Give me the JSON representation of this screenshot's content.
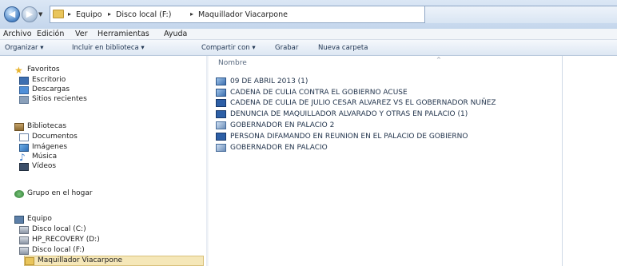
{
  "address_bar": {
    "back_icon": "back-arrow-icon",
    "forward_icon": "forward-arrow-icon",
    "recent_icon": "chevron-down-icon",
    "folder_icon": "folder-icon",
    "breadcrumbs": [
      "Equipo",
      "Disco local (F:)",
      "Maquillador Viacarpone"
    ]
  },
  "menu": {
    "items": [
      "Archivo",
      "Edición",
      "Ver",
      "Herramientas",
      "Ayuda"
    ]
  },
  "command_bar": {
    "items": [
      "Organizar ▾",
      "Incluir en biblioteca ▾",
      "Compartir con ▾",
      "Grabar",
      "Nueva carpeta"
    ]
  },
  "nav": {
    "favorites": {
      "label": "Favoritos",
      "icon": "star-icon",
      "items": [
        {
          "label": "Escritorio",
          "icon": "desktop-icon"
        },
        {
          "label": "Descargas",
          "icon": "downloads-icon"
        },
        {
          "label": "Sitios recientes",
          "icon": "recent-places-icon"
        }
      ]
    },
    "libraries": {
      "label": "Bibliotecas",
      "icon": "libraries-icon",
      "items": [
        {
          "label": "Documentos",
          "icon": "documents-icon"
        },
        {
          "label": "Imágenes",
          "icon": "pictures-icon"
        },
        {
          "label": "Música",
          "icon": "music-icon"
        },
        {
          "label": "Vídeos",
          "icon": "videos-icon"
        }
      ]
    },
    "homegroup": {
      "label": "Grupo en el hogar",
      "icon": "homegroup-icon"
    },
    "computer": {
      "label": "Equipo",
      "icon": "computer-icon",
      "items": [
        {
          "label": "Disco local (C:)",
          "icon": "drive-icon"
        },
        {
          "label": "HP_RECOVERY (D:)",
          "icon": "drive-icon"
        },
        {
          "label": "Disco local (F:)",
          "icon": "drive-icon"
        },
        {
          "label": "Maquillador Viacarpone",
          "icon": "folder-icon",
          "selected": true
        }
      ]
    }
  },
  "files": {
    "column_header": "Nombre",
    "rows": [
      {
        "name": "09 DE ABRIL 2013 (1)",
        "icon": "image-file-icon"
      },
      {
        "name": "CADENA DE CULIA CONTRA EL GOBIERNO ACUSE",
        "icon": "image-file-icon"
      },
      {
        "name": "CADENA DE CULIA DE JULIO CESAR ALVAREZ VS EL GOBERNADOR NUÑEZ",
        "icon": "word-document-icon"
      },
      {
        "name": "DENUNCIA DE MAQUILLADOR ALVARADO Y OTRAS EN PALACIO (1)",
        "icon": "word-document-icon"
      },
      {
        "name": "GOBERNADOR EN PALACIO 2",
        "icon": "jpeg-file-icon"
      },
      {
        "name": "PERSONA DIFAMANDO EN REUNION EN EL PALACIO DE GOBIERNO",
        "icon": "word-document-icon"
      },
      {
        "name": "GOBERNADOR EN PALACIO",
        "icon": "jpeg-file-icon"
      }
    ]
  }
}
